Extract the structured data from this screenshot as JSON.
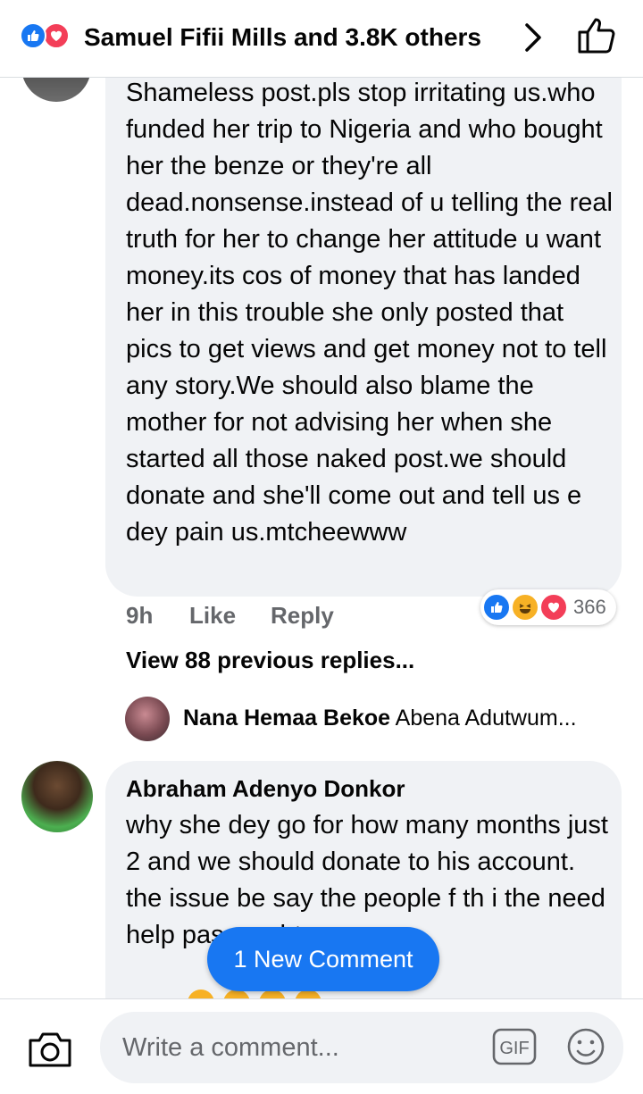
{
  "header": {
    "reactors_label": "Samuel Fifii Mills and 3.8K others",
    "reaction_icons": [
      "like-icon",
      "love-icon"
    ]
  },
  "comment1": {
    "text": "Shameless post.pls stop irritating us.who funded her trip to Nigeria and who bought her the benze or they're all dead.nonsense.instead of u telling the real truth for her to change her attitude u want money.its cos of money that has landed her in this trouble she only posted that pics to get views and get money not to tell any story.We should also blame the mother for not advising her when she started all those naked post.we should donate and she'll come out and tell us e dey pain us.mtcheewww",
    "time": "9h",
    "like_label": "Like",
    "reply_label": "Reply",
    "reaction_count": "366",
    "reaction_icons": [
      "like-icon",
      "haha-icon",
      "love-icon"
    ]
  },
  "replies": {
    "view_previous_label": "View 88 previous replies...",
    "preview_name": "Nana Hemaa Bekoe",
    "preview_text": "Abena Adutwum..."
  },
  "comment2": {
    "author": "Abraham Adenyo Donkor",
    "text": "why she dey go for how many months just 2 and we should donate to his account. the issue be say the people f   th   i   the need help pass a                              ght"
  },
  "new_comment_label": "1 New Comment",
  "footer": {
    "placeholder": "Write a comment...",
    "gif_label": "GIF"
  },
  "colors": {
    "accent": "#1877f2",
    "love": "#f33e58",
    "haha": "#f7b125",
    "bubble": "#f0f2f5",
    "muted": "#65676b"
  }
}
